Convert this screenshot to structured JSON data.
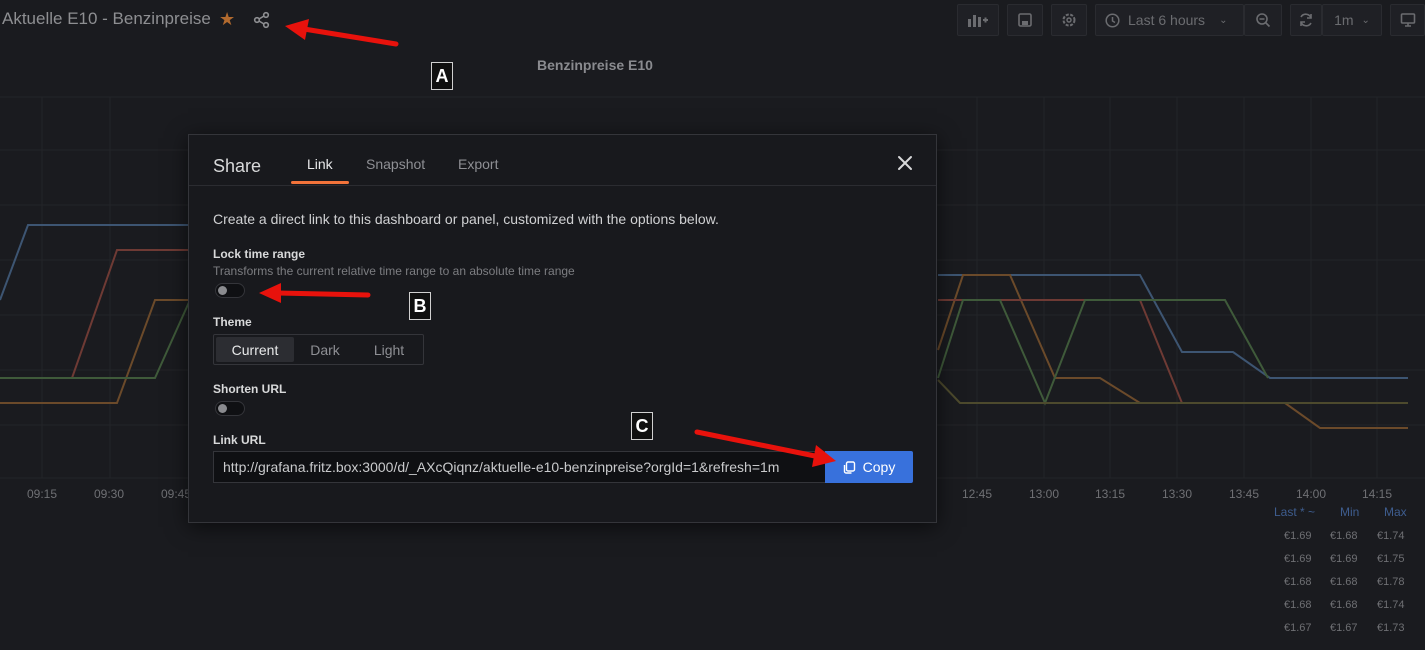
{
  "dashboard": {
    "title": "Aktuelle E10 - Benzinpreise"
  },
  "toolbar": {
    "time_range": "Last 6 hours",
    "refresh_interval": "1m"
  },
  "panel": {
    "title": "Benzinpreise E10",
    "x_labels": [
      "09:15",
      "09:30",
      "09:45",
      "12:45",
      "13:00",
      "13:15",
      "13:30",
      "13:45",
      "14:00",
      "14:15"
    ],
    "legend_headers": [
      "Last * ~",
      "Min",
      "Max"
    ],
    "legend_rows": [
      [
        "€1.69",
        "€1.68",
        "€1.74"
      ],
      [
        "€1.69",
        "€1.69",
        "€1.75"
      ],
      [
        "€1.68",
        "€1.68",
        "€1.78"
      ],
      [
        "€1.68",
        "€1.68",
        "€1.74"
      ],
      [
        "€1.67",
        "€1.67",
        "€1.73"
      ]
    ]
  },
  "modal": {
    "title": "Share",
    "tabs": [
      "Link",
      "Snapshot",
      "Export"
    ],
    "active_tab": "Link",
    "description": "Create a direct link to this dashboard or panel, customized with the options below.",
    "lock_time_range": {
      "label": "Lock time range",
      "help": "Transforms the current relative time range to an absolute time range",
      "enabled": false
    },
    "theme": {
      "label": "Theme",
      "options": [
        "Current",
        "Dark",
        "Light"
      ],
      "selected": "Current"
    },
    "shorten_url": {
      "label": "Shorten URL",
      "enabled": false
    },
    "link_url": {
      "label": "Link URL",
      "value": "http://grafana.fritz.box:3000/d/_AXcQiqnz/aktuelle-e10-benzinpreise?orgId=1&refresh=1m"
    },
    "copy_label": "Copy"
  },
  "annotations": {
    "a": "A",
    "b": "B",
    "c": "C"
  },
  "colors": {
    "accent": "#f2733a",
    "primary_button": "#3871dc",
    "arrow": "#e8120c"
  }
}
